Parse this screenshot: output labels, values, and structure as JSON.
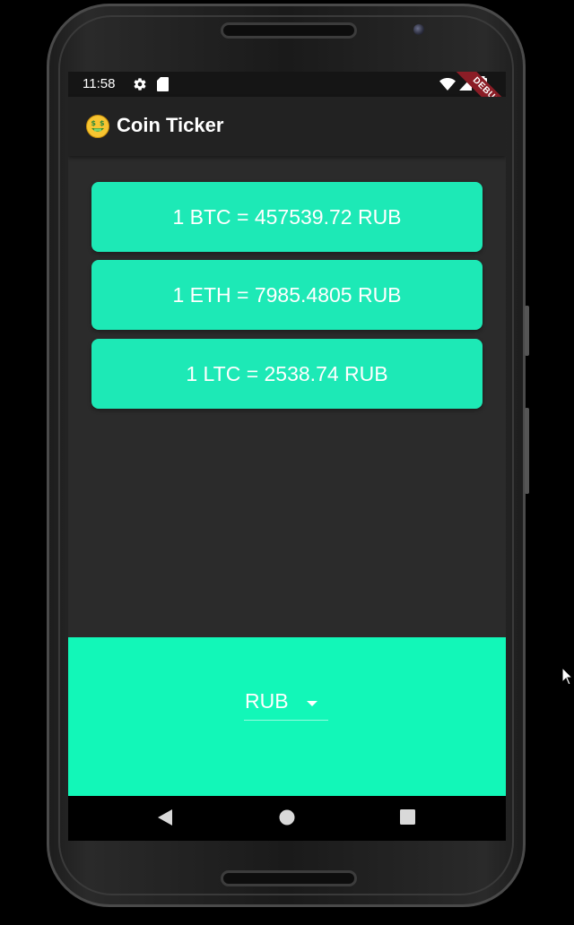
{
  "status_bar": {
    "time": "11:58",
    "debug_label": "DEBUG"
  },
  "app_bar": {
    "emoji_icon": "money-mouth-face-icon",
    "title": "Coin Ticker"
  },
  "rates": [
    {
      "coin": "BTC",
      "text": "1 BTC = 457539.72 RUB"
    },
    {
      "coin": "ETH",
      "text": "1 ETH = 7985.4805 RUB"
    },
    {
      "coin": "LTC",
      "text": "1 LTC = 2538.74 RUB"
    }
  ],
  "currency_picker": {
    "selected": "RUB"
  },
  "colors": {
    "accent": "#1de9b6",
    "bottom_panel": "#12f7b8",
    "background": "#2b2b2b",
    "app_bar": "#222222"
  }
}
